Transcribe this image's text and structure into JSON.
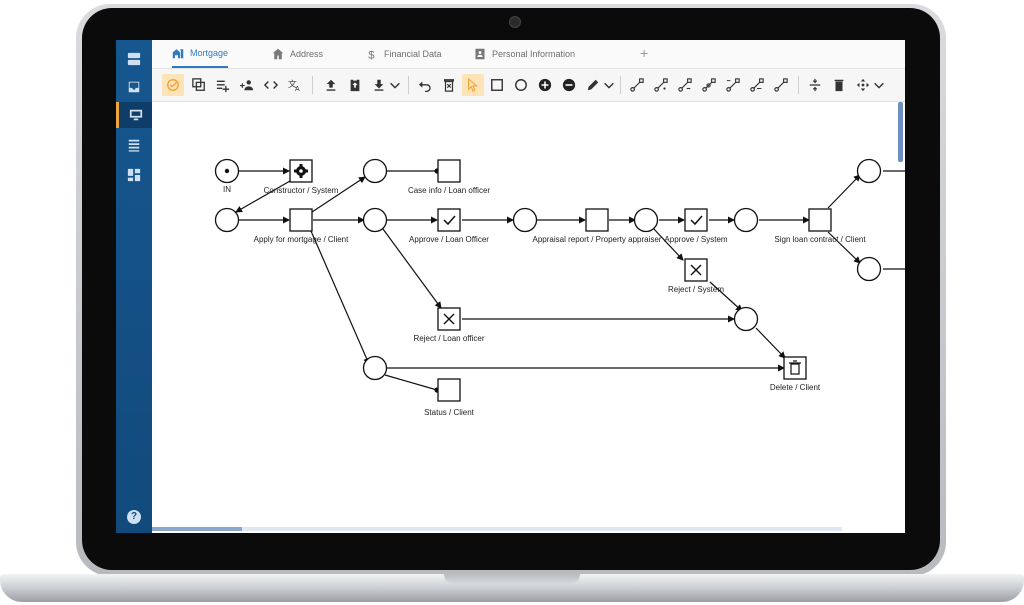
{
  "tabs": [
    {
      "label": "Mortgage",
      "icon": "home-network-icon",
      "active": true
    },
    {
      "label": "Address",
      "icon": "home-icon",
      "active": false
    },
    {
      "label": "Financial Data",
      "icon": "dollar-icon",
      "active": false
    },
    {
      "label": "Personal Information",
      "icon": "contact-card-icon",
      "active": false
    }
  ],
  "tab_add": "+",
  "sidebar": {
    "items": [
      "inbox-stack-icon",
      "inbox-icon",
      "monitor-icon",
      "list-icon",
      "dashboard-icon"
    ],
    "help": "?"
  },
  "diagram": {
    "start_label": "IN",
    "transitions": [
      "Constructor / System",
      "Case info / Loan officer",
      "Apply for mortgage / Client",
      "Approve / Loan Officer",
      "Appraisal report / Property appraiser",
      "Approve / System",
      "Sign loan contract / Client",
      "Reject / System",
      "Reject / Loan officer",
      "Delete / Client",
      "Status / Client"
    ]
  },
  "colors": {
    "sidebar": "#124a7c",
    "accent": "#2f7cc3",
    "selected_tool": "#fde3b8",
    "highlight": "#f0a53c"
  }
}
